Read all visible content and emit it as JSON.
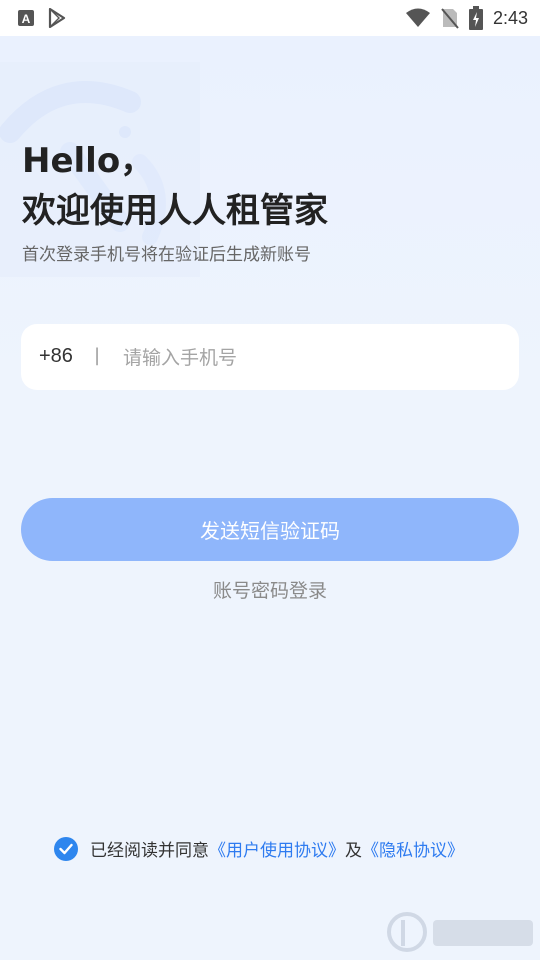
{
  "status_bar": {
    "time": "2:43",
    "icons": [
      "a-icon",
      "play-store-icon",
      "wifi-icon",
      "no-sim-icon",
      "battery-charging-icon"
    ]
  },
  "header": {
    "greeting_line1": "Hello，",
    "greeting_line2": "欢迎使用人人租管家",
    "subtitle": "首次登录手机号将在验证后生成新账号"
  },
  "phone": {
    "country_code": "+86",
    "separator": "|",
    "placeholder": "请输入手机号",
    "value": ""
  },
  "actions": {
    "send_code_label": "发送短信验证码",
    "password_login_label": "账号密码登录"
  },
  "agreement": {
    "checked": true,
    "prefix": "已经阅读并同意",
    "user_agreement": "《用户使用协议》",
    "and": "及",
    "privacy_policy": "《隐私协议》"
  },
  "colors": {
    "accent": "#2e86ee",
    "button_disabled": "#8fb6fb",
    "background": "#eef4fd"
  }
}
